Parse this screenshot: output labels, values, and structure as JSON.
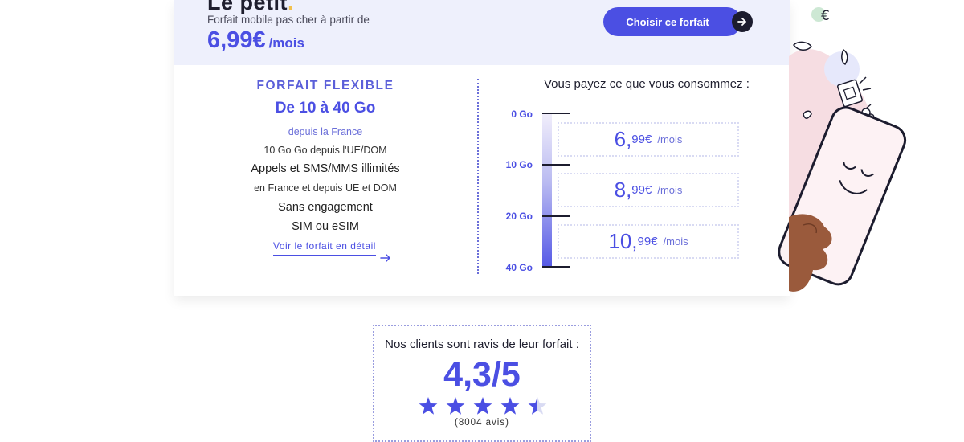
{
  "plan": {
    "title": "Le petit",
    "title_dot": ".",
    "subtitle": "Forfait mobile pas cher à partir de",
    "price": "6,99€",
    "per": "/mois",
    "cta_label": "Choisir ce forfait"
  },
  "flex": {
    "title": "FORFAIT FLEXIBLE",
    "range": "De 10 à 40 Go",
    "from_france": "depuis la France",
    "eu_data": "10 Go Go depuis l'UE/DOM",
    "calls": "Appels et SMS/MMS illimités",
    "calls_sub": "en France et depuis UE et DOM",
    "commitment": "Sans engagement",
    "sim": "SIM ou eSIM",
    "detail_link": "Voir le forfait en détail"
  },
  "consumption": {
    "title": "Vous payez ce que vous consommez :",
    "levels": [
      {
        "label": "0 Go"
      },
      {
        "label": "10 Go"
      },
      {
        "label": "20 Go"
      },
      {
        "label": "40 Go"
      }
    ],
    "tiers": [
      {
        "big": "6,",
        "cents": "99€",
        "unit": "/mois"
      },
      {
        "big": "8,",
        "cents": "99€",
        "unit": "/mois"
      },
      {
        "big": "10,",
        "cents": "99€",
        "unit": "/mois"
      }
    ]
  },
  "reviews": {
    "title": "Nos clients sont ravis de leur forfait :",
    "score": "4,3/5",
    "rating": 4.3,
    "rating_max": 5,
    "count": "(8004 avis)"
  },
  "colors": {
    "accent": "#4b4fe3",
    "header_bg": "#eef0fc",
    "dark": "#1c1c2e",
    "pink_blob": "#f6dde2",
    "highlight": "#f2c14e"
  },
  "icons": {
    "cta_arrow": "arrow-right-icon",
    "detail_arrow": "arrow-right-icon",
    "euro_coin": "euro-icon",
    "star": "star-icon"
  }
}
